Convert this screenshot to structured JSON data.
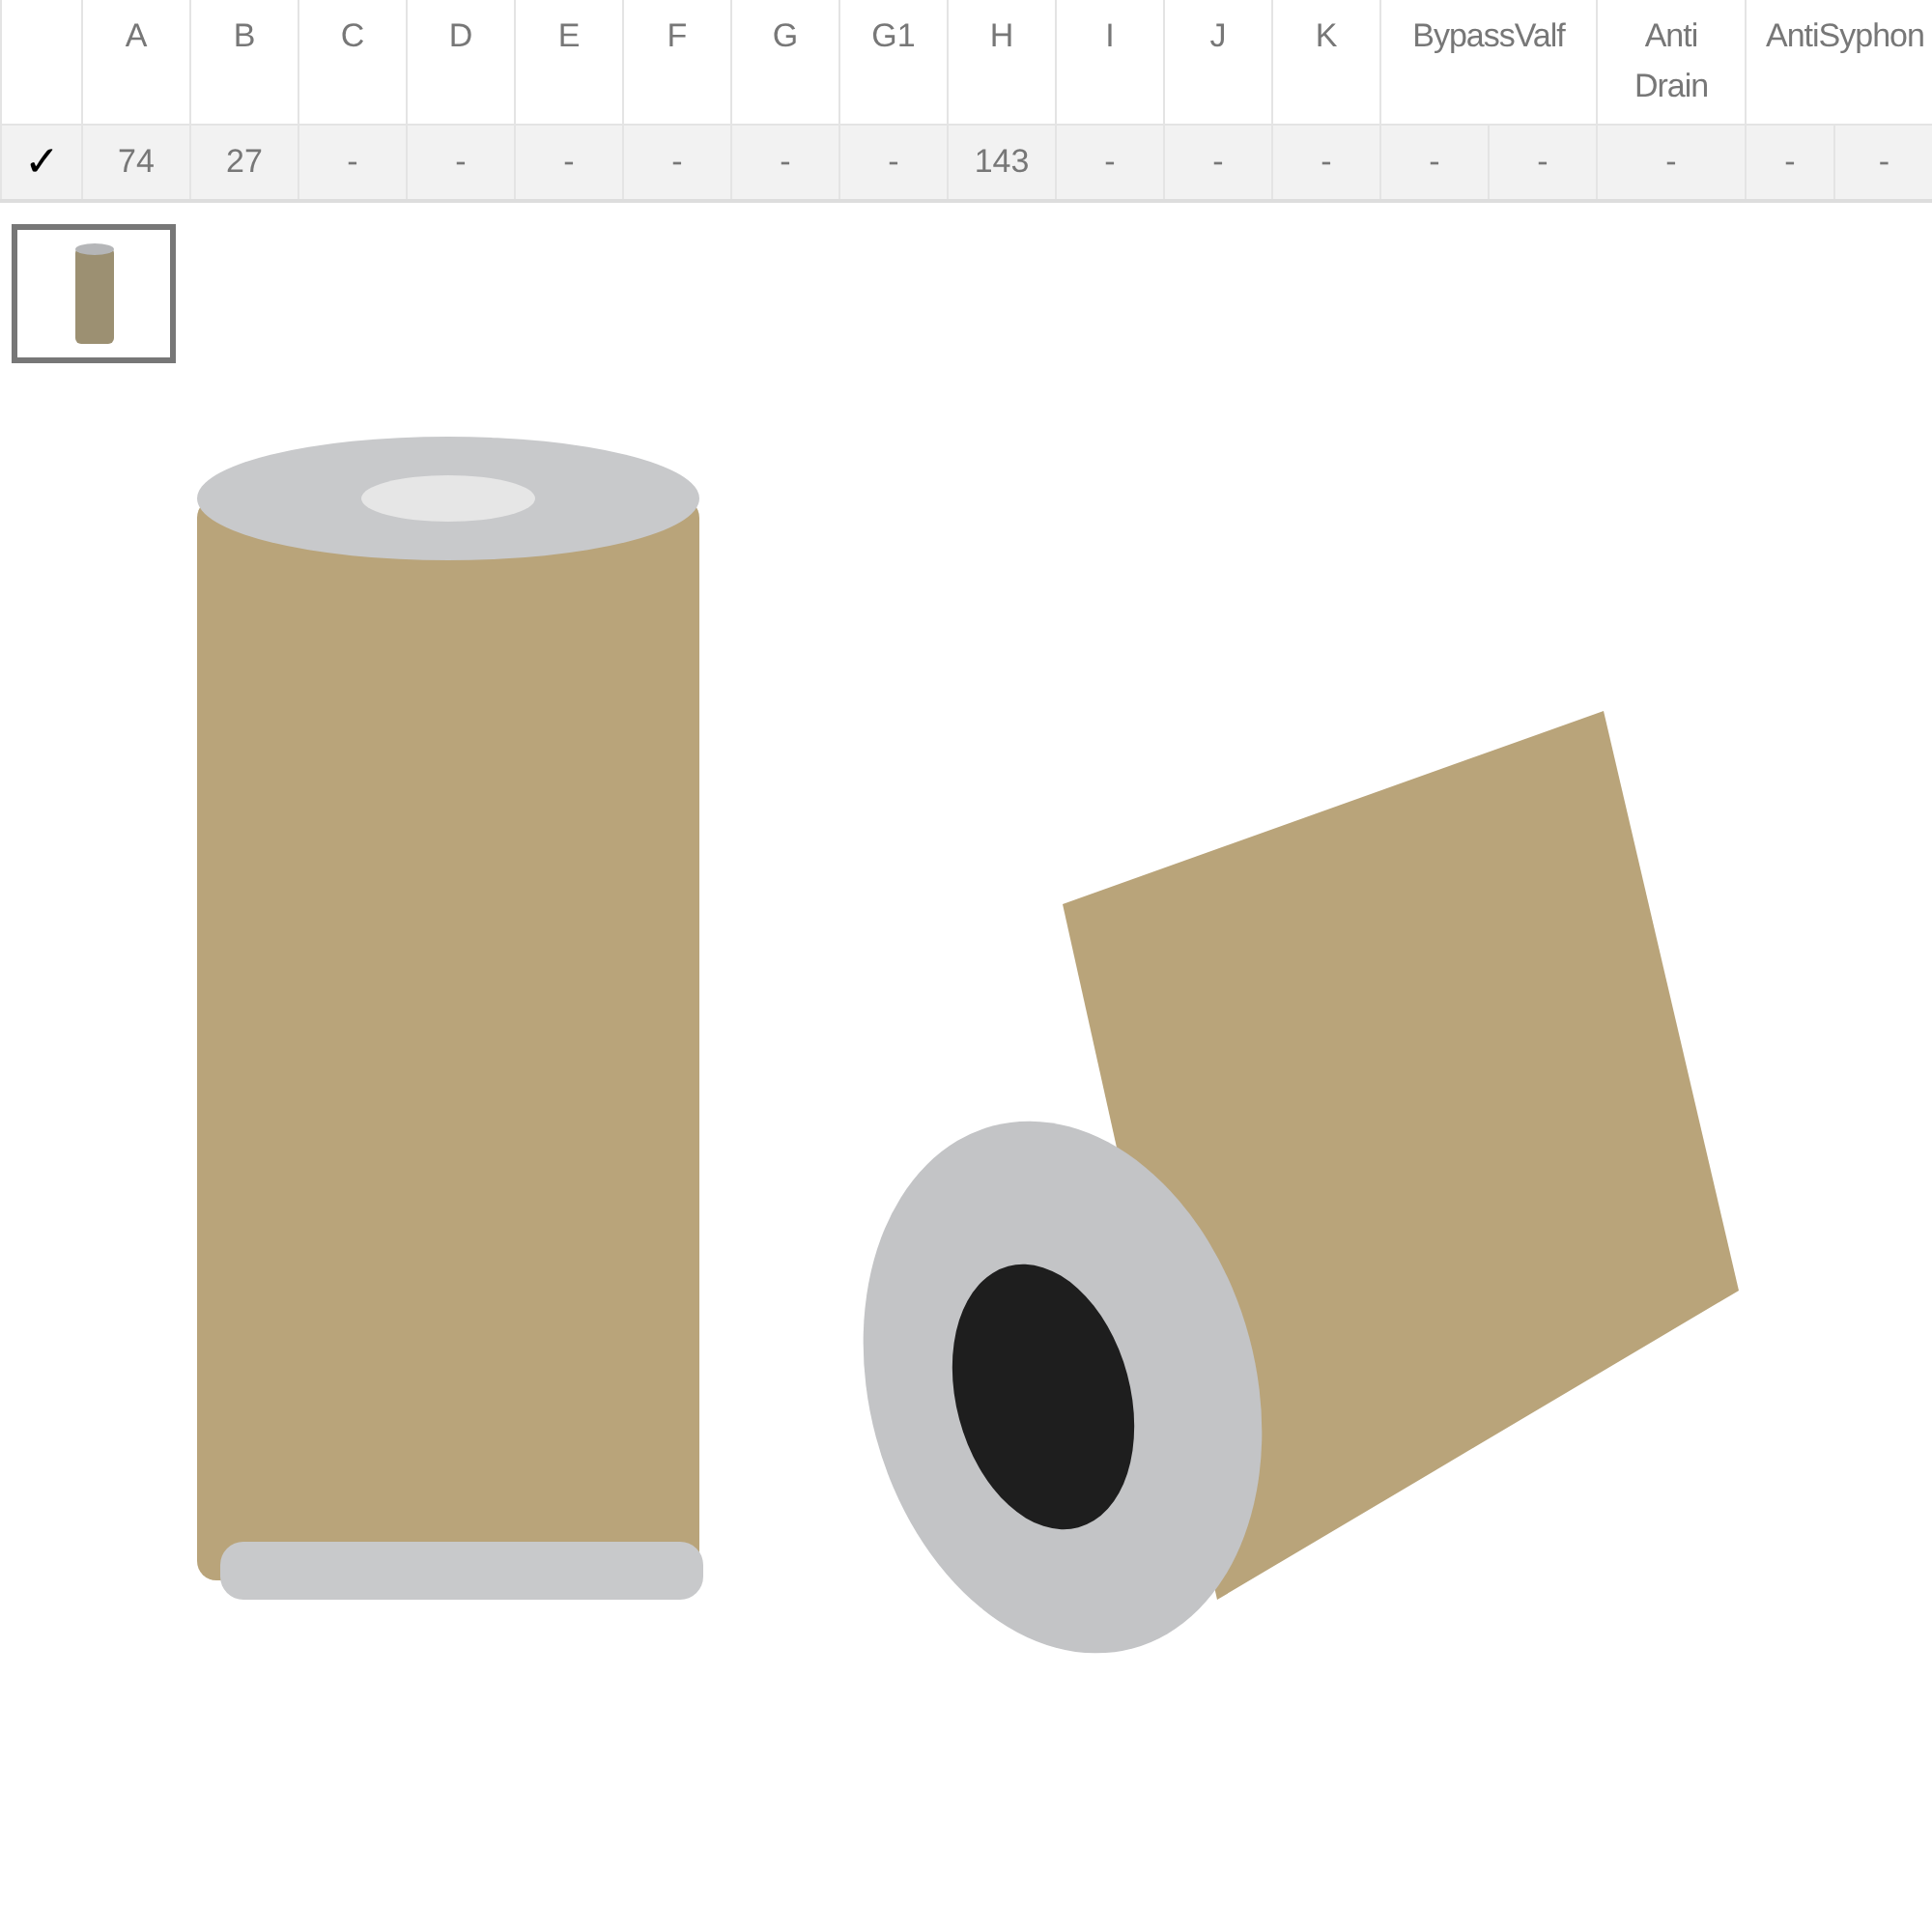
{
  "table": {
    "columns": [
      "A",
      "B",
      "C",
      "D",
      "E",
      "F",
      "G",
      "G1",
      "H",
      "I",
      "J",
      "K",
      "BypassValf",
      "Anti Drain",
      "AntiSyphon"
    ],
    "rows": [
      {
        "mark": "✓",
        "cells": [
          "74",
          "27",
          "-",
          "-",
          "-",
          "-",
          "-",
          "-",
          "143",
          "-",
          "-",
          "-",
          [
            "-",
            "-"
          ],
          "-",
          [
            "-",
            "-"
          ]
        ]
      }
    ]
  },
  "thumbnails": [
    {
      "selected": true
    }
  ]
}
